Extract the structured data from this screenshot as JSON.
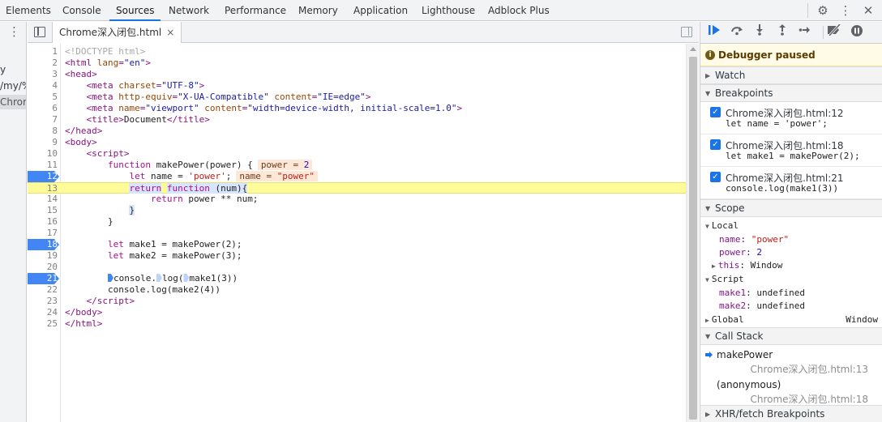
{
  "top_tabs": [
    "Elements",
    "Console",
    "Sources",
    "Network",
    "Performance",
    "Memory",
    "Application",
    "Lighthouse",
    "Adblock Plus"
  ],
  "active_tab": "Sources",
  "navigator": {
    "rows": [
      "y",
      "/my/%",
      "Chrom"
    ]
  },
  "editor": {
    "file_tab": "Chrome深入闭包.html",
    "close_glyph": "×"
  },
  "code": {
    "lines": [
      {
        "n": "1",
        "html": "<span class=\"t-doc\">&lt;!DOCTYPE html&gt;</span>"
      },
      {
        "n": "2",
        "html": "<span class=\"t-tag\">&lt;html </span><span class=\"t-attr\">lang</span><span class=\"t-tag\">=</span><span class=\"t-val\">\"en\"</span><span class=\"t-tag\">&gt;</span>"
      },
      {
        "n": "3",
        "html": "<span class=\"t-tag\">&lt;head&gt;</span>"
      },
      {
        "n": "4",
        "html": "    <span class=\"t-tag\">&lt;meta </span><span class=\"t-attr\">charset</span><span class=\"t-tag\">=</span><span class=\"t-val\">\"UTF-8\"</span><span class=\"t-tag\">&gt;</span>"
      },
      {
        "n": "5",
        "html": "    <span class=\"t-tag\">&lt;meta </span><span class=\"t-attr\">http-equiv</span><span class=\"t-tag\">=</span><span class=\"t-val\">\"X-UA-Compatible\"</span> <span class=\"t-attr\">content</span><span class=\"t-tag\">=</span><span class=\"t-val\">\"IE=edge\"</span><span class=\"t-tag\">&gt;</span>"
      },
      {
        "n": "6",
        "html": "    <span class=\"t-tag\">&lt;meta </span><span class=\"t-attr\">name</span><span class=\"t-tag\">=</span><span class=\"t-val\">\"viewport\"</span> <span class=\"t-attr\">content</span><span class=\"t-tag\">=</span><span class=\"t-val\">\"width=device-width, initial-scale=1.0\"</span><span class=\"t-tag\">&gt;</span>"
      },
      {
        "n": "7",
        "html": "    <span class=\"t-tag\">&lt;title&gt;</span><span class=\"t-pl\">Document</span><span class=\"t-tag\">&lt;/title&gt;</span>"
      },
      {
        "n": "8",
        "html": "<span class=\"t-tag\">&lt;/head&gt;</span>"
      },
      {
        "n": "9",
        "html": "<span class=\"t-tag\">&lt;body&gt;</span>"
      },
      {
        "n": "10",
        "html": "    <span class=\"t-tag\">&lt;script&gt;</span>"
      },
      {
        "n": "11",
        "html": "        <span class=\"t-kw\">function</span> makePower(power) {<span class=\"inline-val\">power = <span class=\"n\">2</span></span>"
      },
      {
        "n": "12",
        "bp": true,
        "html": "            <span class=\"t-kw\">let</span> name = <span class=\"t-str\">'power'</span>;<span class=\"inline-val\">name = <span class=\"v\">\"power\"</span></span>"
      },
      {
        "n": "13",
        "exec": true,
        "html": "            <span class=\"cont-hl\"><span class=\"t-kw\">return</span></span> <span class=\"cont-hl\"><span class=\"t-kw\">function</span> (num){</span>"
      },
      {
        "n": "14",
        "html": "                <span class=\"t-kw\">return</span> power ** num;"
      },
      {
        "n": "15",
        "html": "            <span class=\"cont-hl\">}</span>"
      },
      {
        "n": "16",
        "html": "        }"
      },
      {
        "n": "17",
        "html": ""
      },
      {
        "n": "18",
        "bp": true,
        "html": "        <span class=\"t-kw\">let</span> make1 = makePower(2);"
      },
      {
        "n": "19",
        "html": "        <span class=\"t-kw\">let</span> make2 = makePower(3);"
      },
      {
        "n": "20",
        "html": ""
      },
      {
        "n": "21",
        "bp": true,
        "html": "        <span class=\"inline-bp\"></span>console.<span class=\"inline-bp hollow\"></span>log(<span class=\"inline-bp hollow\"></span>make1(3))"
      },
      {
        "n": "22",
        "html": "        console.log(make2(4))"
      },
      {
        "n": "23",
        "html": "    <span class=\"t-tag\">&lt;/script&gt;</span>"
      },
      {
        "n": "24",
        "html": "<span class=\"t-tag\">&lt;/body&gt;</span>"
      },
      {
        "n": "25",
        "html": "<span class=\"t-tag\">&lt;/html&gt;</span>"
      }
    ]
  },
  "debugger": {
    "paused_text": "Debugger paused",
    "sections": {
      "watch": "Watch",
      "breakpoints": "Breakpoints",
      "scope": "Scope",
      "call_stack": "Call Stack",
      "xhr": "XHR/fetch Breakpoints"
    },
    "breakpoints": [
      {
        "location": "Chrome深入闭包.html:12",
        "source": "let name = 'power';"
      },
      {
        "location": "Chrome深入闭包.html:18",
        "source": "let make1 = makePower(2);"
      },
      {
        "location": "Chrome深入闭包.html:21",
        "source": "console.log(make1(3))"
      }
    ],
    "scope": {
      "local_label": "Local",
      "local": [
        {
          "key": "name",
          "value": "\"power\"",
          "kind": "str"
        },
        {
          "key": "power",
          "value": "2",
          "kind": "num"
        },
        {
          "key": "this",
          "value": "Window",
          "kind": "plain",
          "expandable": true
        }
      ],
      "script_label": "Script",
      "script": [
        {
          "key": "make1",
          "value": "undefined",
          "kind": "plain"
        },
        {
          "key": "make2",
          "value": "undefined",
          "kind": "plain"
        }
      ],
      "global_label": "Global",
      "global_value": "Window"
    },
    "call_stack": [
      {
        "name": "makePower",
        "location": "Chrome深入闭包.html:13",
        "current": true
      },
      {
        "name": "(anonymous)",
        "location": "Chrome深入闭包.html:18",
        "current": false
      }
    ]
  },
  "colors": {
    "accent": "#1a73e8",
    "breakpoint": "#4285f4",
    "exec_line": "#fffb99",
    "paused_banner": "#fffbe6"
  }
}
